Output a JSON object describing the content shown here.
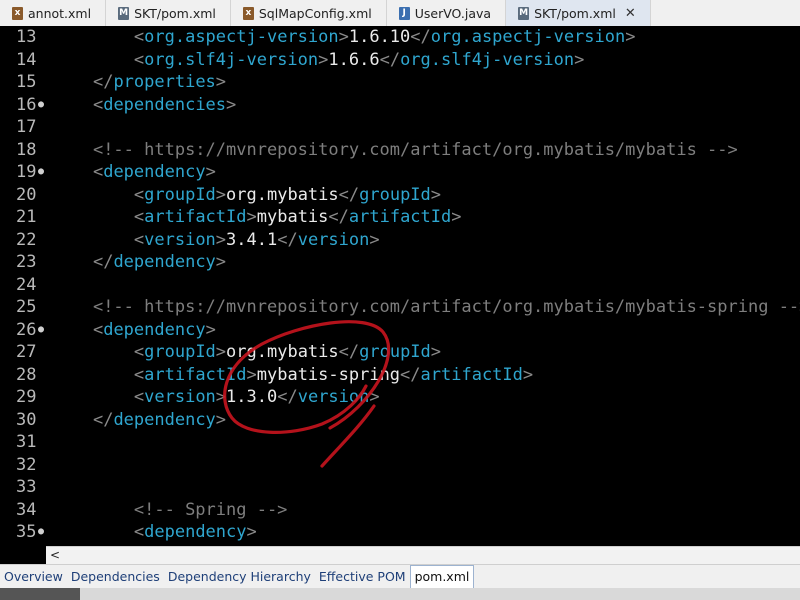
{
  "tabs": [
    {
      "label": "annot.xml",
      "icon": "xml-file-icon",
      "active": false
    },
    {
      "label": "SKT/pom.xml",
      "icon": "maven-file-icon",
      "active": false
    },
    {
      "label": "SqlMapConfig.xml",
      "icon": "xml-file-icon",
      "active": false
    },
    {
      "label": "UserVO.java",
      "icon": "java-file-icon",
      "active": false
    },
    {
      "label": "SKT/pom.xml",
      "icon": "maven-file-icon",
      "active": true
    }
  ],
  "close_glyph": "✕",
  "lines": [
    {
      "n": "13",
      "fold": false,
      "tokens": [
        [
          "v",
          "        "
        ],
        [
          "b",
          "<"
        ],
        [
          "t",
          "org.aspectj-version"
        ],
        [
          "b",
          ">"
        ],
        [
          "v",
          "1.6.10"
        ],
        [
          "b",
          "</"
        ],
        [
          "t",
          "org.aspectj-version"
        ],
        [
          "b",
          ">"
        ]
      ]
    },
    {
      "n": "14",
      "fold": false,
      "tokens": [
        [
          "v",
          "        "
        ],
        [
          "b",
          "<"
        ],
        [
          "t",
          "org.slf4j-version"
        ],
        [
          "b",
          ">"
        ],
        [
          "v",
          "1.6.6"
        ],
        [
          "b",
          "</"
        ],
        [
          "t",
          "org.slf4j-version"
        ],
        [
          "b",
          ">"
        ]
      ]
    },
    {
      "n": "15",
      "fold": false,
      "tokens": [
        [
          "v",
          "    "
        ],
        [
          "b",
          "</"
        ],
        [
          "t",
          "properties"
        ],
        [
          "b",
          ">"
        ]
      ]
    },
    {
      "n": "16",
      "fold": true,
      "tokens": [
        [
          "v",
          "    "
        ],
        [
          "b",
          "<"
        ],
        [
          "t",
          "dependencies"
        ],
        [
          "b",
          ">"
        ]
      ]
    },
    {
      "n": "17",
      "fold": false,
      "tokens": []
    },
    {
      "n": "18",
      "fold": false,
      "tokens": [
        [
          "v",
          "    "
        ],
        [
          "c",
          "<!-- https://mvnrepository.com/artifact/org.mybatis/mybatis -->"
        ]
      ]
    },
    {
      "n": "19",
      "fold": true,
      "tokens": [
        [
          "v",
          "    "
        ],
        [
          "b",
          "<"
        ],
        [
          "t",
          "dependency"
        ],
        [
          "b",
          ">"
        ]
      ]
    },
    {
      "n": "20",
      "fold": false,
      "tokens": [
        [
          "v",
          "        "
        ],
        [
          "b",
          "<"
        ],
        [
          "t",
          "groupId"
        ],
        [
          "b",
          ">"
        ],
        [
          "v",
          "org.mybatis"
        ],
        [
          "b",
          "</"
        ],
        [
          "t",
          "groupId"
        ],
        [
          "b",
          ">"
        ]
      ]
    },
    {
      "n": "21",
      "fold": false,
      "tokens": [
        [
          "v",
          "        "
        ],
        [
          "b",
          "<"
        ],
        [
          "t",
          "artifactId"
        ],
        [
          "b",
          ">"
        ],
        [
          "v",
          "mybatis"
        ],
        [
          "b",
          "</"
        ],
        [
          "t",
          "artifactId"
        ],
        [
          "b",
          ">"
        ]
      ]
    },
    {
      "n": "22",
      "fold": false,
      "tokens": [
        [
          "v",
          "        "
        ],
        [
          "b",
          "<"
        ],
        [
          "t",
          "version"
        ],
        [
          "b",
          ">"
        ],
        [
          "v",
          "3.4.1"
        ],
        [
          "b",
          "</"
        ],
        [
          "t",
          "version"
        ],
        [
          "b",
          ">"
        ]
      ]
    },
    {
      "n": "23",
      "fold": false,
      "tokens": [
        [
          "v",
          "    "
        ],
        [
          "b",
          "</"
        ],
        [
          "t",
          "dependency"
        ],
        [
          "b",
          ">"
        ]
      ]
    },
    {
      "n": "24",
      "fold": false,
      "tokens": []
    },
    {
      "n": "25",
      "fold": false,
      "tokens": [
        [
          "v",
          "    "
        ],
        [
          "c",
          "<!-- https://mvnrepository.com/artifact/org.mybatis/mybatis-spring -->"
        ]
      ]
    },
    {
      "n": "26",
      "fold": true,
      "tokens": [
        [
          "v",
          "    "
        ],
        [
          "b",
          "<"
        ],
        [
          "t",
          "dependency"
        ],
        [
          "b",
          ">"
        ]
      ]
    },
    {
      "n": "27",
      "fold": false,
      "tokens": [
        [
          "v",
          "        "
        ],
        [
          "b",
          "<"
        ],
        [
          "t",
          "groupId"
        ],
        [
          "b",
          ">"
        ],
        [
          "v",
          "org.mybatis"
        ],
        [
          "b",
          "</"
        ],
        [
          "t",
          "groupId"
        ],
        [
          "b",
          ">"
        ]
      ]
    },
    {
      "n": "28",
      "fold": false,
      "tokens": [
        [
          "v",
          "        "
        ],
        [
          "b",
          "<"
        ],
        [
          "t",
          "artifactId"
        ],
        [
          "b",
          ">"
        ],
        [
          "v",
          "mybatis-spring"
        ],
        [
          "b",
          "</"
        ],
        [
          "t",
          "artifactId"
        ],
        [
          "b",
          ">"
        ]
      ]
    },
    {
      "n": "29",
      "fold": false,
      "tokens": [
        [
          "v",
          "        "
        ],
        [
          "b",
          "<"
        ],
        [
          "t",
          "version"
        ],
        [
          "b",
          ">"
        ],
        [
          "v",
          "1.3.0"
        ],
        [
          "b",
          "</"
        ],
        [
          "t",
          "version"
        ],
        [
          "b",
          ">"
        ]
      ]
    },
    {
      "n": "30",
      "fold": false,
      "tokens": [
        [
          "v",
          "    "
        ],
        [
          "b",
          "</"
        ],
        [
          "t",
          "dependency"
        ],
        [
          "b",
          ">"
        ]
      ]
    },
    {
      "n": "31",
      "fold": false,
      "tokens": []
    },
    {
      "n": "32",
      "fold": false,
      "tokens": []
    },
    {
      "n": "33",
      "fold": false,
      "tokens": []
    },
    {
      "n": "34",
      "fold": false,
      "tokens": [
        [
          "v",
          "        "
        ],
        [
          "c",
          "<!-- Spring -->"
        ]
      ]
    },
    {
      "n": "35",
      "fold": true,
      "tokens": [
        [
          "v",
          "        "
        ],
        [
          "b",
          "<"
        ],
        [
          "t",
          "dependency"
        ],
        [
          "b",
          ">"
        ]
      ]
    }
  ],
  "scroll_left_glyph": "<",
  "bottom_tabs": [
    {
      "label": "Overview",
      "active": false
    },
    {
      "label": "Dependencies",
      "active": false
    },
    {
      "label": "Dependency Hierarchy",
      "active": false
    },
    {
      "label": "Effective POM",
      "active": false
    },
    {
      "label": "pom.xml",
      "active": true
    }
  ],
  "colors": {
    "tag": "#2fa6cf",
    "bracket": "#8a8a8a",
    "comment": "#7e7e7e",
    "text": "#eaeaea",
    "annotation": "#c8141e"
  }
}
